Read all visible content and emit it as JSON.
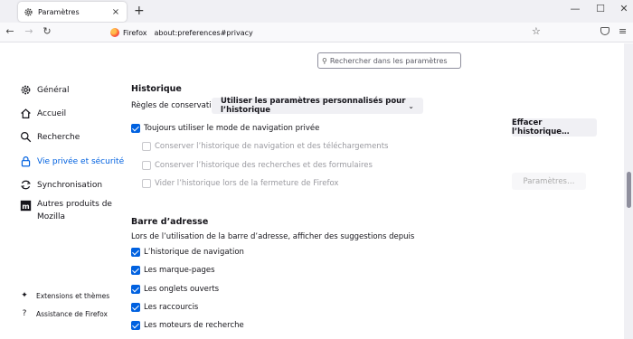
{
  "tab": {
    "title": "Paramètres",
    "close": "×"
  },
  "toolbar": {
    "new_tab": "+",
    "minimize": "—",
    "maximize": "☐",
    "close": "✕",
    "back": "←",
    "forward": "→",
    "reload": "↻",
    "star": "☆",
    "menu": "≡"
  },
  "urlbar": {
    "identity": "Firefox",
    "url": "about:preferences#privacy"
  },
  "search": {
    "placeholder": "Rechercher dans les paramètres"
  },
  "sidebar": {
    "items": [
      {
        "label": "Général",
        "icon": "gear-icon"
      },
      {
        "label": "Accueil",
        "icon": "home-icon"
      },
      {
        "label": "Recherche",
        "icon": "search-icon"
      },
      {
        "label": "Vie privée et sécurité",
        "icon": "lock-icon",
        "active": true
      },
      {
        "label": "Synchronisation",
        "icon": "sync-icon"
      },
      {
        "label": "Autres produits de Mozilla",
        "icon": "mozilla-icon"
      }
    ],
    "footer": [
      {
        "label": "Extensions et thèmes",
        "icon": "extensions-icon"
      },
      {
        "label": "Assistance de Firefox",
        "icon": "help-icon"
      }
    ]
  },
  "history": {
    "title": "Historique",
    "rules_label": "Règles de conservation",
    "rules_value": "Utiliser les paramètres personnalisés pour l’historique",
    "clear_button": "Effacer l’historique…",
    "settings_button": "Paramètres…",
    "options": [
      {
        "label": "Toujours utiliser le mode de navigation privée",
        "checked": true,
        "disabled": false
      },
      {
        "label": "Conserver l’historique de navigation et des téléchargements",
        "checked": false,
        "disabled": true
      },
      {
        "label": "Conserver l’historique des recherches et des formulaires",
        "checked": false,
        "disabled": true
      },
      {
        "label": "Vider l’historique lors de la fermeture de Firefox",
        "checked": false,
        "disabled": true
      }
    ]
  },
  "address_bar": {
    "title": "Barre d’adresse",
    "description": "Lors de l’utilisation de la barre d’adresse, afficher des suggestions depuis",
    "options": [
      {
        "label": "L’historique de navigation",
        "checked": true
      },
      {
        "label": "Les marque-pages",
        "checked": true
      },
      {
        "label": "Les onglets ouverts",
        "checked": true
      },
      {
        "label": "Les raccourcis",
        "checked": true
      },
      {
        "label": "Les moteurs de recherche",
        "checked": true
      }
    ]
  },
  "colors": {
    "accent": "#0061e0",
    "toolbar": "#f0f0f4"
  }
}
